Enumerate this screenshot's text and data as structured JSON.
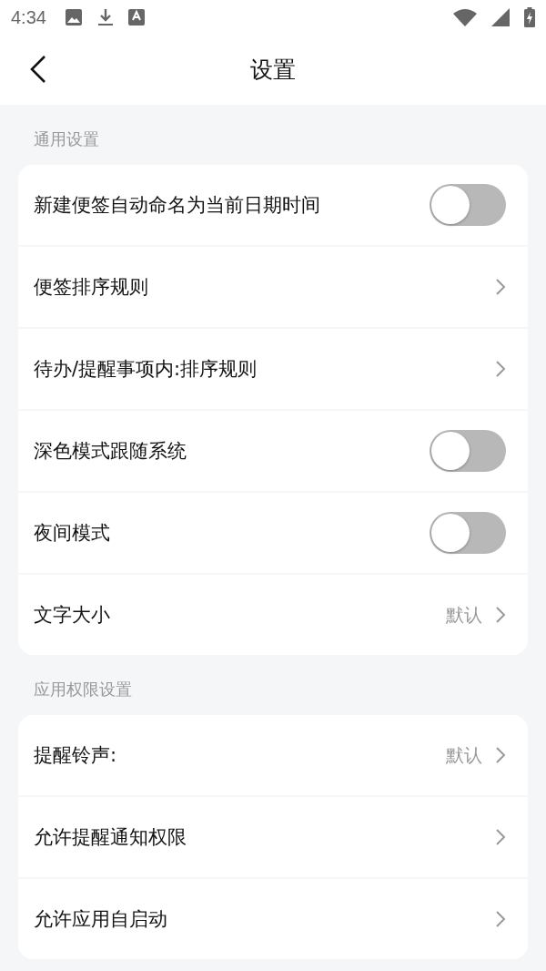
{
  "status_bar": {
    "time": "4:34"
  },
  "header": {
    "title": "设置"
  },
  "sections": [
    {
      "title": "通用设置",
      "rows": [
        {
          "kind": "toggle",
          "label": "新建便签自动命名为当前日期时间",
          "on": false
        },
        {
          "kind": "link",
          "label": "便签排序规则"
        },
        {
          "kind": "link",
          "label": "待办/提醒事项内:排序规则"
        },
        {
          "kind": "toggle",
          "label": "深色模式跟随系统",
          "on": false
        },
        {
          "kind": "toggle",
          "label": "夜间模式",
          "on": false
        },
        {
          "kind": "link",
          "label": "文字大小",
          "value": "默认"
        }
      ]
    },
    {
      "title": "应用权限设置",
      "rows": [
        {
          "kind": "link",
          "label": "提醒铃声:",
          "value": "默认"
        },
        {
          "kind": "link",
          "label": "允许提醒通知权限"
        },
        {
          "kind": "link",
          "label": "允许应用自启动"
        }
      ]
    }
  ]
}
